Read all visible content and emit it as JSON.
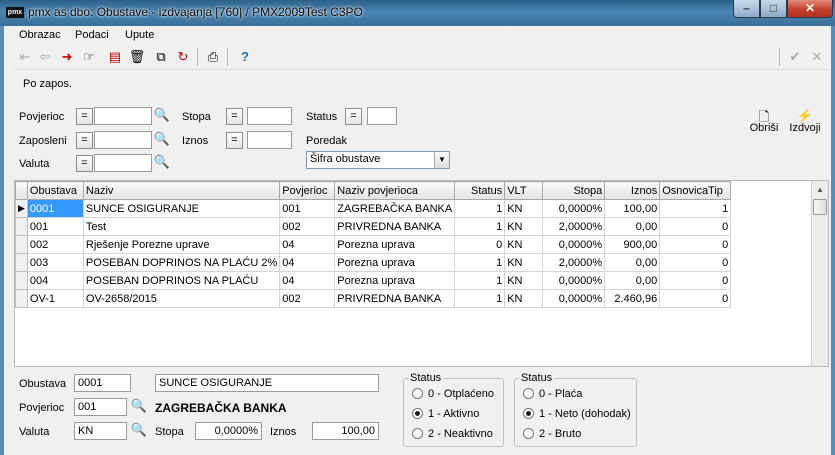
{
  "window": {
    "title": "pmx as dbo: Obustave - izdvajanja [760] / PMX2009Test C3PO",
    "app_icon": "pmx"
  },
  "menu": [
    "Obrazac",
    "Podaci",
    "Upute"
  ],
  "toolbar_icons": [
    "exit-icon",
    "back-icon",
    "forward-red-icon",
    "hand-point-icon",
    "new-doc-icon",
    "trash-icon",
    "copy-doc-icon",
    "refresh-icon",
    "print-icon",
    "help-icon"
  ],
  "toolbar_right_icons": [
    "check-icon",
    "cancel-icon"
  ],
  "filter_mode": "Po zapos.",
  "filters": {
    "povjerioc": {
      "label": "Povjerioc",
      "op": "=",
      "value": ""
    },
    "zaposleni": {
      "label": "Zaposleni",
      "op": "=",
      "value": ""
    },
    "valuta": {
      "label": "Valuta",
      "op": "=",
      "value": ""
    },
    "stopa": {
      "label": "Stopa",
      "op": "=",
      "value": ""
    },
    "iznos": {
      "label": "Iznos",
      "op": "=",
      "value": ""
    },
    "status": {
      "label": "Status",
      "op": "=",
      "value": ""
    },
    "poredak": {
      "label": "Poredak",
      "selected": "Šifra obustave"
    }
  },
  "actions": {
    "obrisi": "Obriši",
    "izdvoji": "Izdvoji"
  },
  "grid": {
    "columns": [
      "Obustava",
      "Naziv",
      "Povjerioc",
      "Naziv povjerioca",
      "Status",
      "VLT",
      "Stopa",
      "Iznos",
      "OsnovicaTip"
    ],
    "rows": [
      [
        "0001",
        "SUNCE OSIGURANJE",
        "001",
        "ZAGREBAČKA BANKA",
        "1",
        "KN",
        "0,0000%",
        "100,00",
        "1"
      ],
      [
        "001",
        "Test",
        "002",
        "PRIVREDNA BANKA",
        "1",
        "KN",
        "2,0000%",
        "0,00",
        "0"
      ],
      [
        "002",
        "Rješenje Porezne uprave",
        "04",
        "Porezna uprava",
        "0",
        "KN",
        "0,0000%",
        "900,00",
        "0"
      ],
      [
        "003",
        "POSEBAN DOPRINOS NA PLAĆU 2%",
        "04",
        "Porezna uprava",
        "1",
        "KN",
        "2,0000%",
        "0,00",
        "0"
      ],
      [
        "004",
        "POSEBAN DOPRINOS NA PLAĆU",
        "04",
        "Porezna uprava",
        "1",
        "KN",
        "0,0000%",
        "0,00",
        "0"
      ],
      [
        "OV-1",
        "OV-2658/2015",
        "002",
        "PRIVREDNA BANKA",
        "1",
        "KN",
        "0,0000%",
        "2.460,96",
        "0"
      ]
    ]
  },
  "detail": {
    "obustava_label": "Obustava",
    "obustava_value": "0001",
    "naziv_value": "SUNCE OSIGURANJE",
    "povjerioc_label": "Povjerioc",
    "povjerioc_value": "001",
    "povjerioc_name": "ZAGREBAČKA BANKA",
    "valuta_label": "Valuta",
    "valuta_value": "KN",
    "stopa_label": "Stopa",
    "stopa_value": "0,0000%",
    "iznos_label": "Iznos",
    "iznos_value": "100,00"
  },
  "status_group1": {
    "title": "Status",
    "options": [
      "0 - Otplaćeno",
      "1 - Aktivno",
      "2 - Neaktivno"
    ],
    "selected_index": 1
  },
  "status_group2": {
    "title": "Status",
    "options": [
      "0 - Plaća",
      "1 - Neto (dohodak)",
      "2 - Bruto"
    ],
    "selected_index": 1
  }
}
